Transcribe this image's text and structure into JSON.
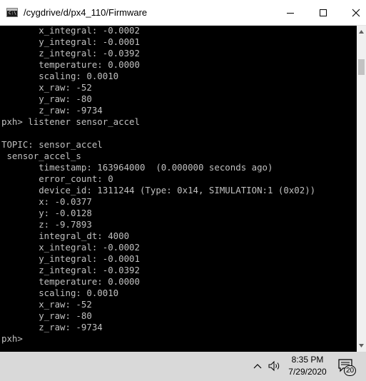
{
  "window": {
    "title": "/cygdrive/d/px4_110/Firmware",
    "app_icon_text": "C:\\"
  },
  "terminal": {
    "lines": [
      "       x_integral: -0.0002",
      "       y_integral: -0.0001",
      "       z_integral: -0.0392",
      "       temperature: 0.0000",
      "       scaling: 0.0010",
      "       x_raw: -52",
      "       y_raw: -80",
      "       z_raw: -9734",
      "pxh> listener sensor_accel",
      "",
      "TOPIC: sensor_accel",
      " sensor_accel_s",
      "       timestamp: 163964000  (0.000000 seconds ago)",
      "       error_count: 0",
      "       device_id: 1311244 (Type: 0x14, SIMULATION:1 (0x02))",
      "       x: -0.0377",
      "       y: -0.0128",
      "       z: -9.7893",
      "       integral_dt: 4000",
      "       x_integral: -0.0002",
      "       y_integral: -0.0001",
      "       z_integral: -0.0392",
      "       temperature: 0.0000",
      "       scaling: 0.0010",
      "       x_raw: -52",
      "       y_raw: -80",
      "       z_raw: -9734",
      "pxh> "
    ]
  },
  "taskbar": {
    "time": "8:35 PM",
    "date": "7/29/2020",
    "notification_count": "20",
    "tray_icons": [
      "chevron-up-icon",
      "speaker-icon",
      "action-center-icon"
    ]
  },
  "colors": {
    "terminal_bg": "#000000",
    "terminal_fg": "#c0c0c0",
    "titlebar_bg": "#ffffff",
    "taskbar_bg": "#d9d9d9"
  }
}
